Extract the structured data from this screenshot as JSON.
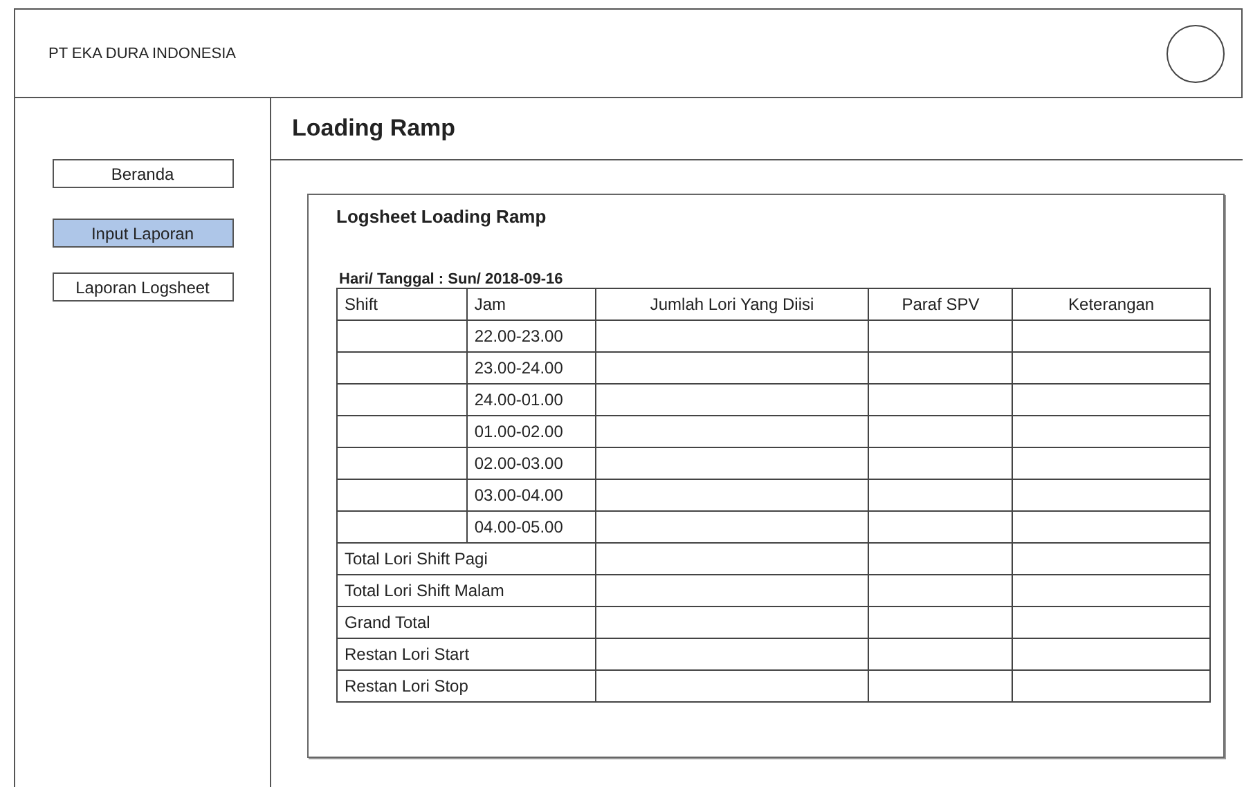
{
  "header": {
    "company": "PT EKA DURA INDONESIA"
  },
  "sidebar": {
    "items": [
      {
        "label": "Beranda",
        "selected": false
      },
      {
        "label": "Input Laporan",
        "selected": true
      },
      {
        "label": "Laporan Logsheet",
        "selected": false
      }
    ]
  },
  "page_title": "Loading Ramp",
  "panel": {
    "title": "Logsheet Loading Ramp",
    "date_label": "Hari/ Tanggal : Sun/ 2018-09-16",
    "table": {
      "columns": [
        "Shift",
        "Jam",
        "Jumlah Lori Yang Diisi",
        "Paraf SPV",
        "Keterangan"
      ],
      "rows": [
        {
          "kind": "hour",
          "jam": "22.00-23.00"
        },
        {
          "kind": "hour",
          "jam": "23.00-24.00"
        },
        {
          "kind": "hour",
          "jam": "24.00-01.00"
        },
        {
          "kind": "hour",
          "jam": "01.00-02.00"
        },
        {
          "kind": "hour",
          "jam": "02.00-03.00"
        },
        {
          "kind": "hour",
          "jam": "03.00-04.00"
        },
        {
          "kind": "hour",
          "jam": "04.00-05.00"
        },
        {
          "kind": "summary",
          "label": "Total Lori Shift Pagi"
        },
        {
          "kind": "summary",
          "label": "Total Lori Shift Malam"
        },
        {
          "kind": "summary",
          "label": "Grand Total"
        },
        {
          "kind": "summary",
          "label": "Restan Lori Start"
        },
        {
          "kind": "summary",
          "label": "Restan Lori Stop"
        }
      ]
    }
  }
}
